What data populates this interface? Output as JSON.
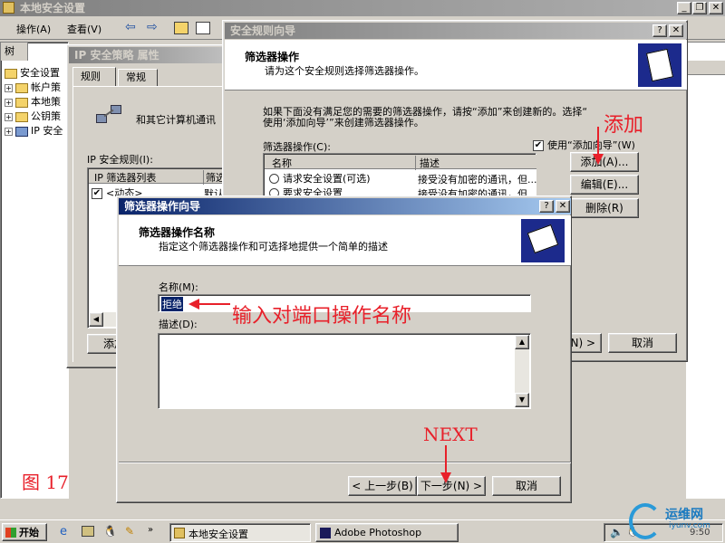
{
  "main_window": {
    "title": "本地安全设置",
    "menu": {
      "action": "操作(A)",
      "view": "查看(V)"
    },
    "tree_tab": "树",
    "tree": [
      {
        "label": "安全设置"
      },
      {
        "label": "帐户策"
      },
      {
        "label": "本地策"
      },
      {
        "label": "公钥策"
      },
      {
        "label": "IP 安全"
      }
    ]
  },
  "ip_policy_window": {
    "title": "IP 安全策略 属性",
    "tabs": {
      "rules": "规则",
      "general": "常规"
    },
    "desc": "和其它计算机通讯",
    "rules_label": "IP 安全规则(I):",
    "columns": {
      "filter_list": "IP 筛选器列表",
      "filter": "筛选"
    },
    "row": {
      "name": "<动态>",
      "value": "默认"
    },
    "add_button": "添加"
  },
  "rule_wizard": {
    "title": "安全规则向导",
    "header_title": "筛选器操作",
    "header_sub": "请为这个安全规则选择筛选器操作。",
    "intro_line1": "如果下面没有满足您的需要的筛选器操作，请按“添加”来创建新的。选择“",
    "intro_line2": "使用‘添加向导’”来创建筛选器操作。",
    "filter_actions_label": "筛选器操作(C):",
    "use_wizard_label": "使用“添加向导”(W)",
    "columns": {
      "name": "名称",
      "desc": "描述"
    },
    "rows": [
      {
        "name": "请求安全设置(可选)",
        "desc": "接受没有加密的通讯，但..."
      },
      {
        "name": "要求安全设置",
        "desc": "接受没有加密的通讯，但..."
      }
    ],
    "add_button": "添加(A)...",
    "edit_button": "编辑(E)...",
    "delete_button": "删除(R)",
    "next_partial": "N) >",
    "cancel_button": "取消"
  },
  "filter_wizard": {
    "title": "筛选器操作向导",
    "header_title": "筛选器操作名称",
    "header_sub": "指定这个筛选器操作和可选择地提供一个简单的描述",
    "name_label": "名称(M):",
    "name_value": "拒绝",
    "desc_label": "描述(D):",
    "back_button": "< 上一步(B)",
    "next_button": "下一步(N) >",
    "cancel_button": "取消"
  },
  "annotations": {
    "add": "添加",
    "input_name": "输入对端口操作名称",
    "next": "NEXT",
    "figure": "图 17"
  },
  "taskbar": {
    "start": "开始",
    "task1": "本地安全设置",
    "task2": "Adobe Photoshop",
    "clock": "9:50",
    "watermark": "运维网",
    "watermark_url": "iyunv.com"
  }
}
